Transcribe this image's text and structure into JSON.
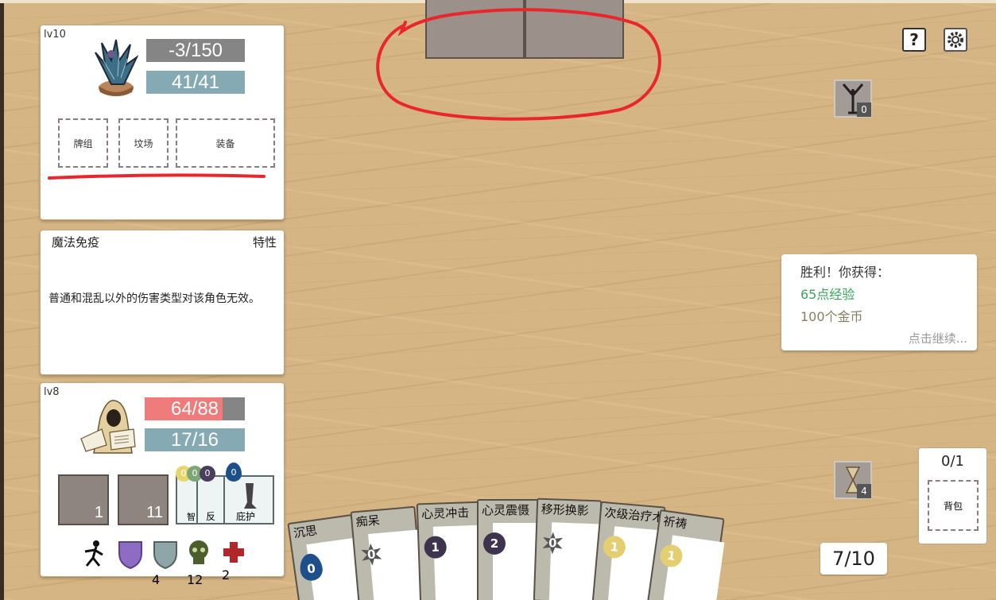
{
  "enemy": {
    "level": "lv10",
    "hp": "-3/150",
    "energy": "41/41",
    "slots": [
      "牌组",
      "坟场",
      "装备"
    ],
    "portrait": "mandrake-plant-portrait",
    "intent_count": "0"
  },
  "trait": {
    "name": "魔法免疫",
    "tag": "特性",
    "description": "普通和混乱以外的伤害类型对该角色无效。"
  },
  "player": {
    "level": "lv8",
    "hp": "64/88",
    "hp_fraction": 0.78,
    "energy": "17/16",
    "portrait": "hooded-scholar-portrait",
    "deck_count": "1",
    "graveyard_count": "11",
    "mini_cards": [
      "智",
      "反",
      "庇护"
    ],
    "mini_costs": [
      "0",
      "0",
      "0",
      "0"
    ],
    "statuses": [
      {
        "icon": "running-stickman-icon",
        "count": ""
      },
      {
        "icon": "purple-shield-icon",
        "count": ""
      },
      {
        "icon": "gray-shield-icon",
        "count": "4"
      },
      {
        "icon": "green-skull-icon",
        "count": "12"
      },
      {
        "icon": "red-cross-icon",
        "count": "2"
      }
    ]
  },
  "hand": [
    {
      "name": "沉思",
      "cost": "0",
      "cost_type": "water"
    },
    {
      "name": "痴呆",
      "cost": "0",
      "cost_type": "star"
    },
    {
      "name": "心灵冲击",
      "cost": "1",
      "cost_type": "moon"
    },
    {
      "name": "心灵震慑",
      "cost": "2",
      "cost_type": "moon"
    },
    {
      "name": "移形换影",
      "cost": "0",
      "cost_type": "star"
    },
    {
      "name": "次级治疗术",
      "cost": "1",
      "cost_type": "sun"
    },
    {
      "name": "祈祷",
      "cost": "1",
      "cost_type": "sun"
    }
  ],
  "victory": {
    "title": "胜利！你获得：",
    "exp": "65点经验",
    "gold": "100个金币",
    "continue": "点击继续..."
  },
  "backpack": {
    "count": "0/1",
    "label": "背包"
  },
  "turn": "7/10",
  "top_icons": {
    "help": "?",
    "settings": "gear-icon"
  },
  "deck_right": {
    "top_count": "0",
    "bottom_count": "4"
  },
  "colors": {
    "hp_enemy": "#858585",
    "hp_player": "#ef7b7b",
    "energy": "#86aab3",
    "annotation": "#e8262b",
    "exp": "#3aa35a",
    "gold": "#8a7c60"
  }
}
